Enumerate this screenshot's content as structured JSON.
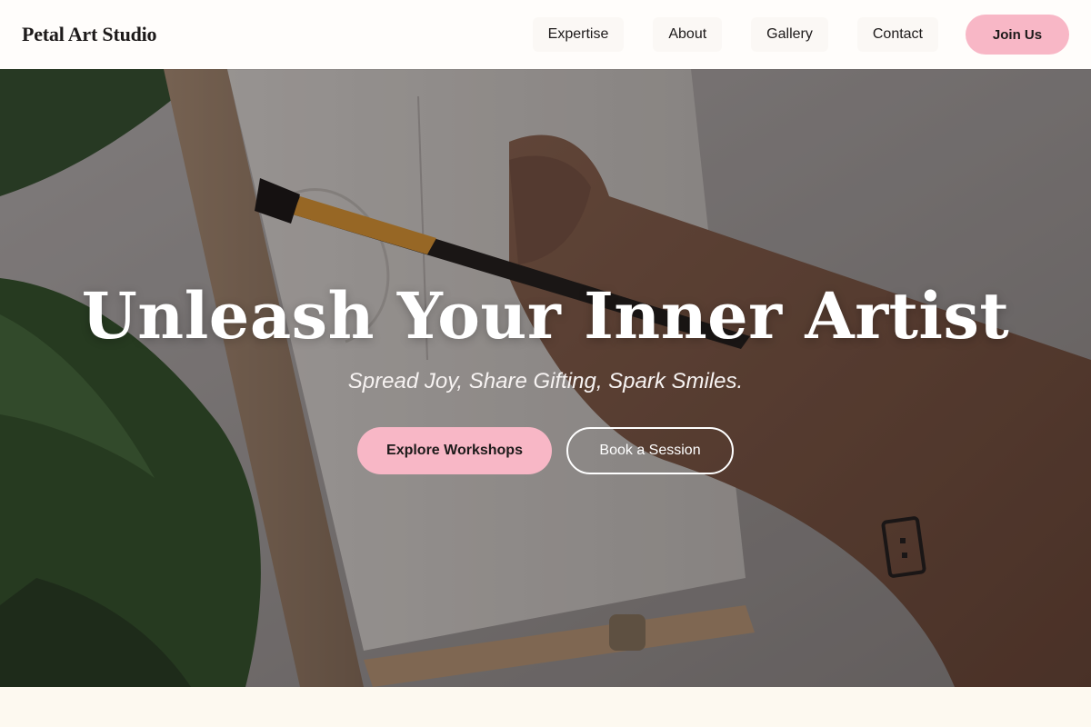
{
  "header": {
    "brand": "Petal Art Studio",
    "nav": [
      {
        "label": "Expertise"
      },
      {
        "label": "About"
      },
      {
        "label": "Gallery"
      },
      {
        "label": "Contact"
      }
    ],
    "join_label": "Join Us"
  },
  "hero": {
    "title": "Unleash Your Inner Artist",
    "subtitle": "Spread Joy, Share Gifting, Spark Smiles.",
    "primary_cta": "Explore Workshops",
    "secondary_cta": "Book a Session"
  },
  "colors": {
    "accent_pink": "#f8b7c6",
    "header_bg": "#fffdfb",
    "page_bg": "#fdf9f0",
    "text_dark": "#1d1a1a"
  },
  "icons": [
    "hero-painting-photo"
  ]
}
